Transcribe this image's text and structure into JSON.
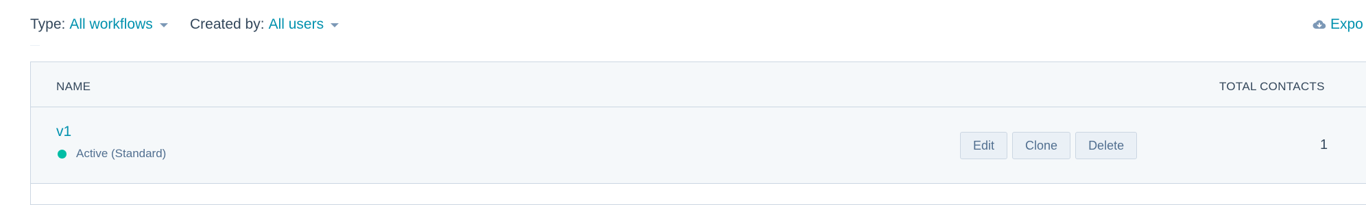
{
  "filters": {
    "type": {
      "label": "Type:",
      "value": "All workflows"
    },
    "created_by": {
      "label": "Created by:",
      "value": "All users"
    }
  },
  "export": {
    "label": "Expo",
    "icon": "cloud-download-icon"
  },
  "table": {
    "columns": {
      "name": "NAME",
      "total_contacts": "TOTAL CONTACTS"
    },
    "rows": [
      {
        "name": "v1",
        "status": "Active (Standard)",
        "status_color": "#00bda5",
        "actions": {
          "edit": "Edit",
          "clone": "Clone",
          "delete": "Delete"
        },
        "total_contacts": "1"
      }
    ]
  },
  "colors": {
    "link": "#0091ae",
    "text": "#33475b",
    "header_bg": "#f5f8fa",
    "border": "#cbd6e2"
  }
}
